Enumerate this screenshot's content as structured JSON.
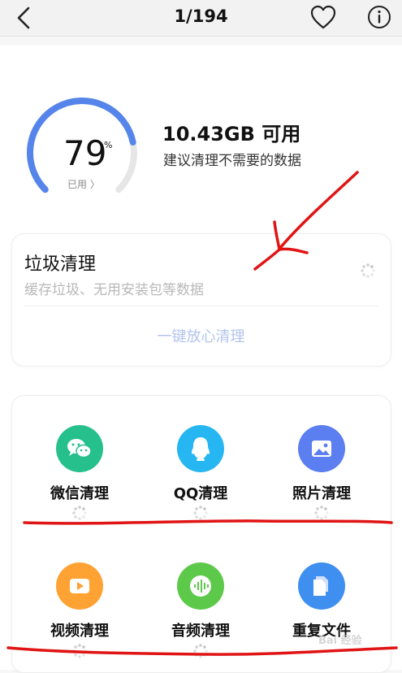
{
  "topbar": {
    "page_counter": "1/194"
  },
  "storage": {
    "used_percent": 79,
    "percent_value": "79",
    "percent_sign": "%",
    "used_label": "已用 〉",
    "available": "10.43GB 可用",
    "advice": "建议清理不需要的数据"
  },
  "junk": {
    "title": "垃圾清理",
    "desc": "缓存垃圾、无用安装包等数据",
    "action": "一键放心清理"
  },
  "tools": [
    {
      "label": "微信清理",
      "color": "#25c08b",
      "icon": "wechat-icon"
    },
    {
      "label": "QQ清理",
      "color": "#26b6f1",
      "icon": "qq-icon"
    },
    {
      "label": "照片清理",
      "color": "#5b7ef0",
      "icon": "photo-icon"
    },
    {
      "label": "视频清理",
      "color": "#ffa234",
      "icon": "video-icon"
    },
    {
      "label": "音频清理",
      "color": "#5dc94a",
      "icon": "audio-icon"
    },
    {
      "label": "重复文件",
      "color": "#3f8ff0",
      "icon": "duplicate-file-icon"
    }
  ],
  "colors": {
    "gauge": "#5585ea",
    "gauge_track": "#e6e6e6",
    "annotation": "#e01414"
  },
  "watermark": "Bai 经验"
}
